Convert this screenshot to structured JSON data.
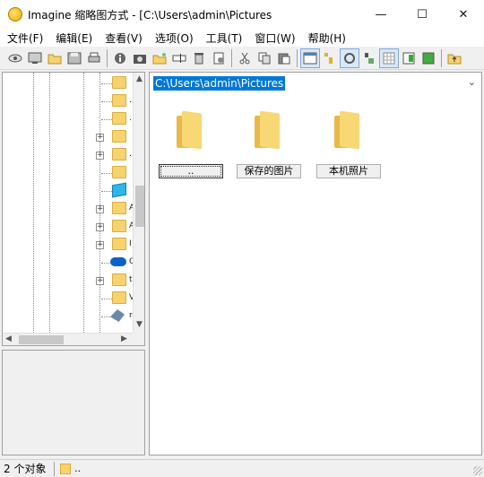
{
  "window": {
    "title": "Imagine 缩略图方式 - [C:\\Users\\admin\\Pictures",
    "minimize_glyph": "—",
    "maximize_glyph": "☐",
    "close_glyph": "✕"
  },
  "menu": [
    {
      "label": "文件(F)"
    },
    {
      "label": "编辑(E)"
    },
    {
      "label": "查看(V)"
    },
    {
      "label": "选项(O)"
    },
    {
      "label": "工具(T)"
    },
    {
      "label": "窗口(W)"
    },
    {
      "label": "帮助(H)"
    }
  ],
  "toolbar": {
    "icons": [
      "view-icon",
      "slideshow-icon",
      "open-folder-icon",
      "save-icon",
      "print-icon",
      "info-icon",
      "camera-icon",
      "new-folder-icon",
      "rename-icon",
      "delete-icon",
      "properties-icon",
      "cut-icon",
      "copy-icon",
      "paste-icon",
      "thumbnail-view-icon",
      "tree-icon",
      "refresh-icon",
      "sort-icon",
      "grid-icon",
      "preview-icon",
      "fullscreen-icon",
      "up-folder-icon"
    ]
  },
  "tree": {
    "labels": [
      ".",
      ".",
      "",
      ".",
      "A",
      "A",
      "A",
      "I",
      "C",
      "t",
      "V",
      "r"
    ]
  },
  "address": {
    "path": "C:\\Users\\admin\\Pictures"
  },
  "thumbnails": [
    {
      "label": ".."
    },
    {
      "label": "保存的图片"
    },
    {
      "label": "本机照片"
    }
  ],
  "status": {
    "count": "2 个对象",
    "current": ".."
  },
  "colors": {
    "selection": "#0078d7",
    "folder": "#f8d775"
  }
}
